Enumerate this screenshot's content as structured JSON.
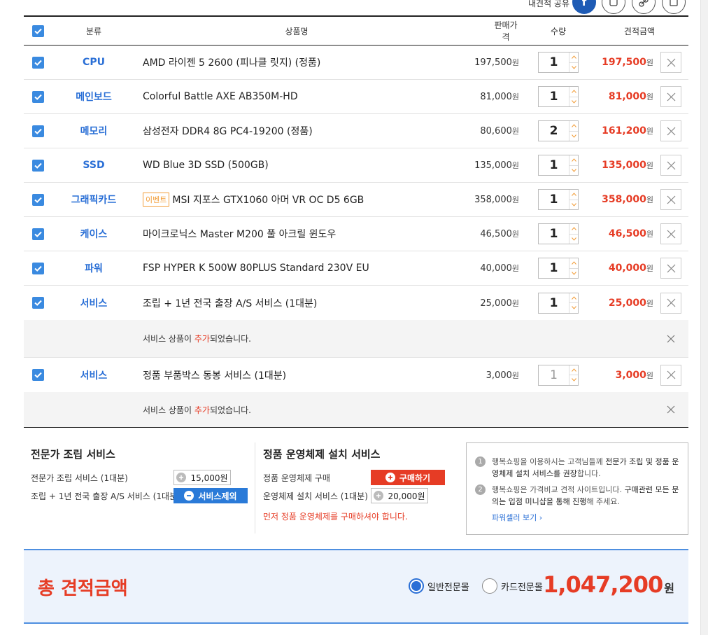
{
  "share": {
    "label": "내견적 공유",
    "buttons": [
      "facebook-icon",
      "share-icon",
      "link-icon",
      "save-icon"
    ]
  },
  "table": {
    "headers": {
      "category": "분류",
      "product": "상품명",
      "price": "판매가격",
      "qty": "수량",
      "total": "견적금액"
    },
    "won": "원",
    "rows": [
      {
        "category": "CPU",
        "product": "AMD 라이젠 5 2600 (피나클 릿지) (정품)",
        "price": "197,500",
        "qty": "1",
        "total": "197,500"
      },
      {
        "category": "메인보드",
        "product": "Colorful Battle AXE AB350M-HD",
        "price": "81,000",
        "qty": "1",
        "total": "81,000"
      },
      {
        "category": "메모리",
        "product": "삼성전자 DDR4 8G PC4-19200 (정품)",
        "price": "80,600",
        "qty": "2",
        "total": "161,200"
      },
      {
        "category": "SSD",
        "product": "WD Blue 3D SSD (500GB)",
        "price": "135,000",
        "qty": "1",
        "total": "135,000"
      },
      {
        "category": "그래픽카드",
        "tag": "이벤트",
        "product": "MSI 지포스 GTX1060 아머 VR OC D5 6GB",
        "price": "358,000",
        "qty": "1",
        "total": "358,000"
      },
      {
        "category": "케이스",
        "product": "마이크로닉스 Master M200 풀 아크릴 윈도우",
        "price": "46,500",
        "qty": "1",
        "total": "46,500"
      },
      {
        "category": "파워",
        "product": "FSP HYPER K 500W 80PLUS Standard 230V EU",
        "price": "40,000",
        "qty": "1",
        "total": "40,000"
      },
      {
        "category": "서비스",
        "product": "조립 + 1년 전국 출장 A/S 서비스 (1대분)",
        "price": "25,000",
        "qty": "1",
        "total": "25,000"
      },
      {
        "category": "서비스",
        "product": "정품 부품박스 동봉 서비스 (1대분)",
        "price": "3,000",
        "qty": "1",
        "total": "3,000"
      }
    ],
    "notice": {
      "before": "서비스 상품이 ",
      "highlight": "추가",
      "after": "되었습니다."
    }
  },
  "services": {
    "assembly": {
      "title": "전문가 조립 서비스",
      "line1_label": "전문가 조립 서비스 (1대분)",
      "line1_button": "15,000원",
      "line2_label": "조립 + 1년 전국 출장 A/S 서비스 (1대분)",
      "line2_button": "서비스제외"
    },
    "os": {
      "title": "정품 운영체제 설치 서비스",
      "line1_label": "정품 운영체제 구매",
      "line1_button": "구매하기",
      "line2_label": "운영체제 설치 서비스 (1대분)",
      "line2_button": "20,000원",
      "warning": "먼저 정품 운영체제를 구매하셔야 합니다."
    },
    "info": {
      "item1_num": "1",
      "item1_text_a": "행복쇼핑을 이용하시는 고객님들께 ",
      "item1_text_b": "전문가 조립 및 정품 운영체제 설치 서비스를 권장",
      "item1_text_c": "합니다.",
      "item2_num": "2",
      "item2_text_a": "행복쇼핑은 가격비교 견적 사이트입니다. ",
      "item2_text_b": "구매관련 모든 문의는 입점 미니샵을 통해 진행",
      "item2_text_c": "해 주세요.",
      "link": "파워셀러 보기 ›"
    }
  },
  "summary": {
    "label": "총 견적금액",
    "radio1": "일반전문몰",
    "radio2": "카드전문몰",
    "amount": "1,047,200",
    "won": "원"
  },
  "colors": {
    "accent_red": "#e63c25",
    "accent_blue": "#2a6fd6",
    "checkbox_blue": "#3a8ae0",
    "summary_bg": "#edf3fc"
  }
}
